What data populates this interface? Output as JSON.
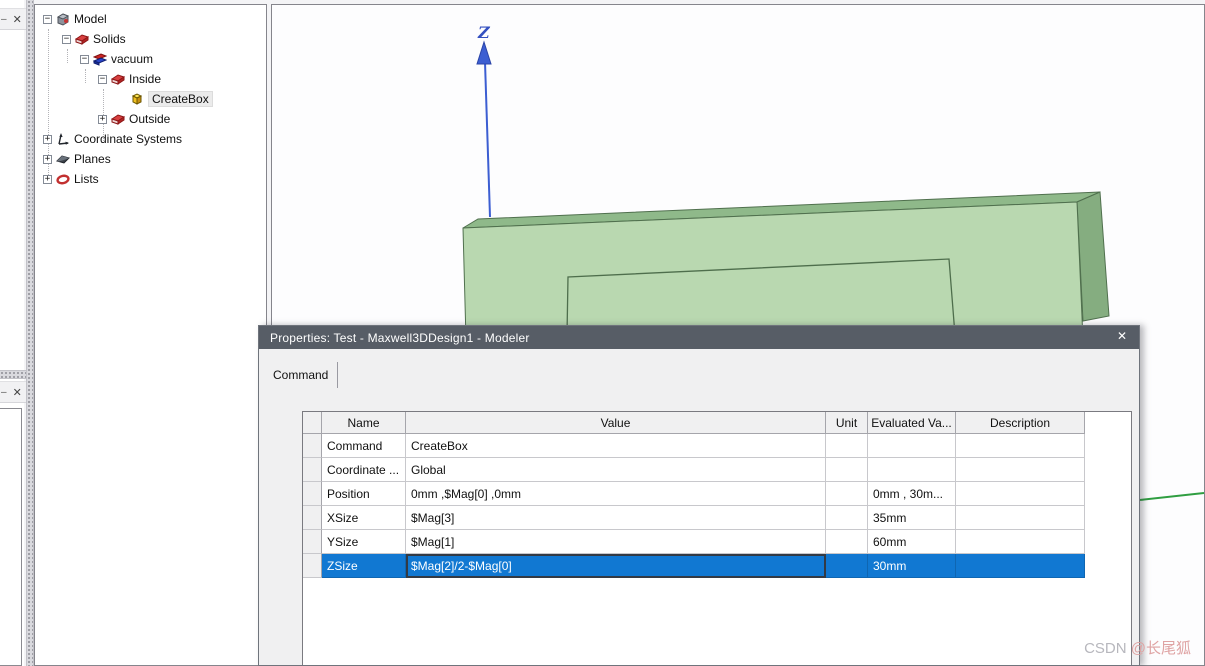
{
  "left_dock": {
    "top_fragment": {
      "dash_glyph": "–",
      "close_glyph": "✕"
    },
    "bottom_fragment": {
      "dash_glyph": "–",
      "close_glyph": "✕"
    }
  },
  "tree": {
    "items": [
      {
        "label": "Model",
        "expander": "−",
        "icon": "model-icon"
      },
      {
        "label": "Solids",
        "expander": "−",
        "icon": "solids-icon"
      },
      {
        "label": "vacuum",
        "expander": "−",
        "icon": "material-icon"
      },
      {
        "label": "Inside",
        "expander": "−",
        "icon": "group-icon"
      },
      {
        "label": "CreateBox",
        "expander": "",
        "icon": "createbox-icon"
      },
      {
        "label": "Outside",
        "expander": "+",
        "icon": "group-icon"
      },
      {
        "label": "Coordinate Systems",
        "expander": "+",
        "icon": "coordinate-icon"
      },
      {
        "label": "Planes",
        "expander": "+",
        "icon": "planes-icon"
      },
      {
        "label": "Lists",
        "expander": "+",
        "icon": "lists-icon"
      }
    ]
  },
  "viewport": {
    "z_axis_label": "Z"
  },
  "dialog": {
    "title": "Properties: Test - Maxwell3DDesign1 - Modeler",
    "close_glyph": "✕",
    "tab_label": "Command",
    "table": {
      "columns": [
        "Name",
        "Value",
        "Unit",
        "Evaluated Va...",
        "Description"
      ],
      "rows": [
        {
          "name": "Command",
          "value": "CreateBox",
          "unit": "",
          "evaluated": "",
          "description": ""
        },
        {
          "name": "Coordinate ...",
          "value": "Global",
          "unit": "",
          "evaluated": "",
          "description": ""
        },
        {
          "name": "Position",
          "value": "0mm ,$Mag[0] ,0mm",
          "unit": "",
          "evaluated": "0mm , 30m...",
          "description": ""
        },
        {
          "name": "XSize",
          "value": "$Mag[3]",
          "unit": "",
          "evaluated": "35mm",
          "description": ""
        },
        {
          "name": "YSize",
          "value": "$Mag[1]",
          "unit": "",
          "evaluated": "60mm",
          "description": ""
        },
        {
          "name": "ZSize",
          "value": "$Mag[2]/2-$Mag[0]",
          "unit": "",
          "evaluated": "30mm",
          "description": ""
        }
      ],
      "selected_row": "ZSize"
    }
  },
  "watermark": {
    "prefix": "CSDN ",
    "suffix": "@长尾狐"
  },
  "colors": {
    "selection_blue": "#1178d2",
    "dialog_titlebar": "#575d66",
    "box_front_green": "#b9d8b0",
    "box_top_green": "#8fb98a",
    "box_side_green": "#85ad80",
    "z_axis_blue": "#3c5ed2",
    "y_axis_green": "#2f9e41"
  }
}
